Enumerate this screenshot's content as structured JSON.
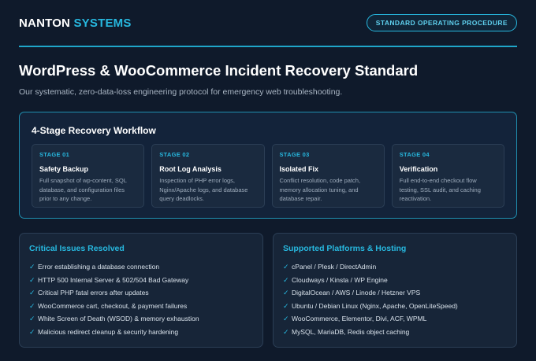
{
  "header": {
    "brand_primary": "NANTON",
    "brand_accent": "SYSTEMS",
    "badge": "STANDARD OPERATING PROCEDURE"
  },
  "page": {
    "title": "WordPress & WooCommerce Incident Recovery Standard",
    "subtitle": "Our systematic, zero-data-loss engineering protocol for emergency web troubleshooting."
  },
  "workflow": {
    "title": "4-Stage Recovery Workflow",
    "stages": [
      {
        "num": "STAGE 01",
        "name": "Safety Backup",
        "desc": "Full snapshot of wp-content, SQL database, and configuration files prior to any change."
      },
      {
        "num": "STAGE 02",
        "name": "Root Log Analysis",
        "desc": "Inspection of PHP error logs, Nginx/Apache logs, and database query deadlocks."
      },
      {
        "num": "STAGE 03",
        "name": "Isolated Fix",
        "desc": "Conflict resolution, code patch, memory allocation tuning, and database repair."
      },
      {
        "num": "STAGE 04",
        "name": "Verification",
        "desc": "Full end-to-end checkout flow testing, SSL audit, and caching reactivation."
      }
    ]
  },
  "issues": {
    "title": "Critical Issues Resolved",
    "items": [
      "Error establishing a database connection",
      "HTTP 500 Internal Server & 502/504 Bad Gateway",
      "Critical PHP fatal errors after updates",
      "WooCommerce cart, checkout, & payment failures",
      "White Screen of Death (WSOD) & memory exhaustion",
      "Malicious redirect cleanup & security hardening"
    ]
  },
  "platforms": {
    "title": "Supported Platforms & Hosting",
    "items": [
      "cPanel / Plesk / DirectAdmin",
      "Cloudways / Kinsta / WP Engine",
      "DigitalOcean / AWS / Linode / Hetzner VPS",
      "Ubuntu / Debian Linux (Nginx, Apache, OpenLiteSpeed)",
      "WooCommerce, Elementor, Divi, ACF, WPML",
      "MySQL, MariaDB, Redis object caching"
    ]
  },
  "icons": {
    "check": "✓"
  },
  "colors": {
    "background": "#0f1a2b",
    "accent": "#27b8df",
    "panel": "#172538"
  }
}
